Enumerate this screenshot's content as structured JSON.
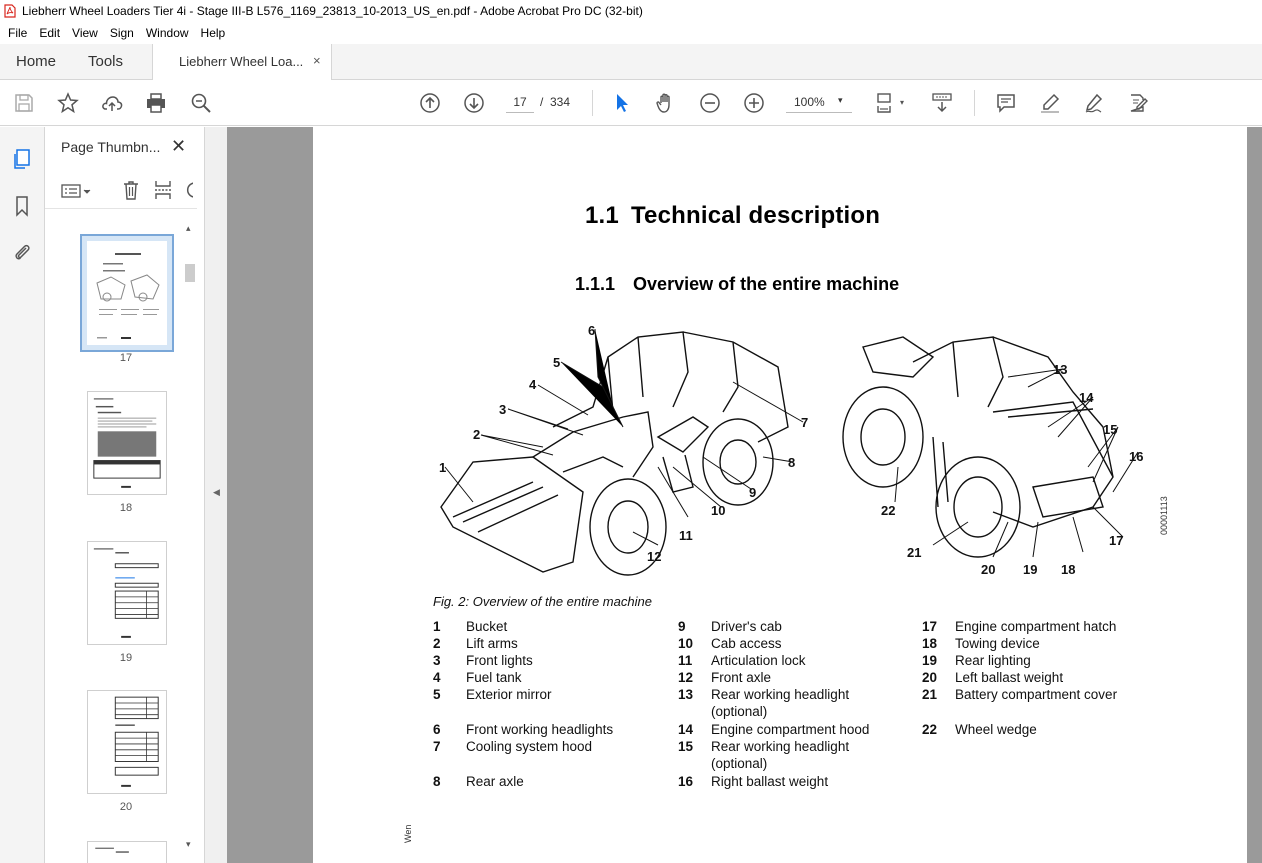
{
  "window": {
    "title": "Liebherr Wheel Loaders Tier 4i - Stage III-B L576_1169_23813_10-2013_US_en.pdf - Adobe Acrobat Pro DC (32-bit)"
  },
  "menu": [
    "File",
    "Edit",
    "View",
    "Sign",
    "Window",
    "Help"
  ],
  "tabs": {
    "home": "Home",
    "tools": "Tools",
    "document": "Liebherr Wheel Loa...",
    "close": "×"
  },
  "toolbar": {
    "current_page": "17",
    "slash": "/",
    "total_pages": "334",
    "zoom": "100%",
    "zoom_arrow": "▾"
  },
  "thumbnails": {
    "title": "Page Thumbn...",
    "close": "✕",
    "pages": [
      "17",
      "18",
      "19",
      "20"
    ]
  },
  "document": {
    "h1_num": "1.1",
    "h1_text": "Technical description",
    "h2_num": "1.1.1",
    "h2_text": "Overview of the entire machine",
    "fig_caption": "Fig. 2: Overview of the entire machine",
    "fig_code": "00001113",
    "footer": "Wen",
    "figure_callouts": [
      "1",
      "2",
      "3",
      "4",
      "5",
      "6",
      "7",
      "8",
      "9",
      "10",
      "11",
      "12",
      "13",
      "14",
      "15",
      "16",
      "17",
      "18",
      "19",
      "20",
      "21",
      "22"
    ],
    "legend": [
      {
        "n": "1",
        "t": "Bucket"
      },
      {
        "n": "2",
        "t": "Lift arms"
      },
      {
        "n": "3",
        "t": "Front lights"
      },
      {
        "n": "4",
        "t": "Fuel tank"
      },
      {
        "n": "5",
        "t": "Exterior mirror"
      },
      {
        "n": "6",
        "t": "Front working headlights"
      },
      {
        "n": "7",
        "t": "Cooling system hood"
      },
      {
        "n": "8",
        "t": "Rear axle"
      },
      {
        "n": "9",
        "t": "Driver's cab"
      },
      {
        "n": "10",
        "t": "Cab access"
      },
      {
        "n": "11",
        "t": "Articulation lock"
      },
      {
        "n": "12",
        "t": "Front axle"
      },
      {
        "n": "13",
        "t": "Rear working headlight"
      },
      {
        "n": "13b",
        "t": "(optional)"
      },
      {
        "n": "14",
        "t": "Engine compartment hood"
      },
      {
        "n": "15",
        "t": "Rear working headlight"
      },
      {
        "n": "15b",
        "t": "(optional)"
      },
      {
        "n": "16",
        "t": "Right ballast weight"
      },
      {
        "n": "17",
        "t": "Engine compartment hatch"
      },
      {
        "n": "18",
        "t": "Towing device"
      },
      {
        "n": "19",
        "t": "Rear lighting"
      },
      {
        "n": "20",
        "t": "Left ballast weight"
      },
      {
        "n": "21",
        "t": "Battery compartment cover"
      },
      {
        "n": "22",
        "t": "Wheel wedge"
      }
    ]
  },
  "colors": {
    "accent": "#1473e6",
    "panel_bg": "#f4f4f4",
    "doc_bg": "#9a9a9a"
  }
}
